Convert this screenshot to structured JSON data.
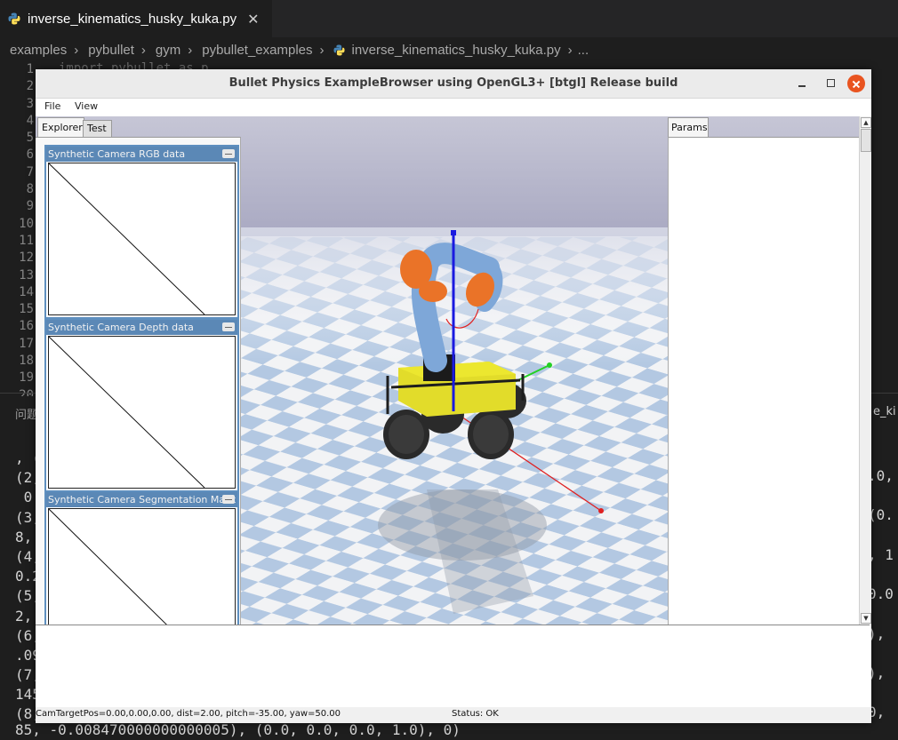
{
  "editor": {
    "tab_title": "inverse_kinematics_husky_kuka.py",
    "tab_close": "✕",
    "breadcrumb": [
      "examples",
      "pybullet",
      "gym",
      "pybullet_examples",
      "inverse_kinematics_husky_kuka.py",
      "..."
    ],
    "breadcrumb_sep": "›",
    "line_numbers": [
      "1",
      "2",
      "3",
      "4",
      "5",
      "6",
      "7",
      "8",
      "9",
      "10",
      "11",
      "12",
      "13",
      "14",
      "15",
      "16",
      "17",
      "18",
      "19",
      "20"
    ],
    "code_line_1": "import pybullet as p",
    "panel_tab_left": "问题",
    "panel_tab_right": "e_ki",
    "terminal_left": [
      ", (",
      "(2,",
      " 0.",
      "(3,",
      "8, ",
      "(4,",
      "0.2",
      "(5,",
      "2, ",
      "(6,",
      ".09",
      "(7,",
      "145",
      "(8,"
    ],
    "terminal_right": [
      ".0,",
      "",
      "(0.",
      "",
      ", 1",
      "",
      "0.0",
      "",
      "),",
      "",
      "),",
      "",
      "0,"
    ],
    "terminal_bottom": "85, -0.008470000000000005), (0.0, 0.0, 0.0, 1.0), 0)"
  },
  "bullet_window": {
    "title": "Bullet Physics ExampleBrowser using OpenGL3+ [btgl] Release build",
    "menu": [
      "File",
      "View"
    ],
    "tabs": {
      "explorer": "Explorer",
      "test": "Test",
      "params": "Params"
    },
    "cameras": [
      {
        "title": "Synthetic Camera RGB data"
      },
      {
        "title": "Synthetic Camera Depth data"
      },
      {
        "title": "Synthetic Camera Segmentation Mask"
      }
    ],
    "status_camera": "CamTargetPos=0.00,0.00,0.00, dist=2.00, pitch=-35.00, yaw=50.00",
    "status_ok": "Status: OK"
  },
  "colors": {
    "floor_blue": "#b4c9e3",
    "floor_white": "#f4f4f4",
    "sky": "#c3c3d4",
    "kuka_blue": "#7aa4d6",
    "kuka_orange": "#e8722a",
    "husky_yellow": "#e6e12c",
    "close_button": "#e95420"
  }
}
